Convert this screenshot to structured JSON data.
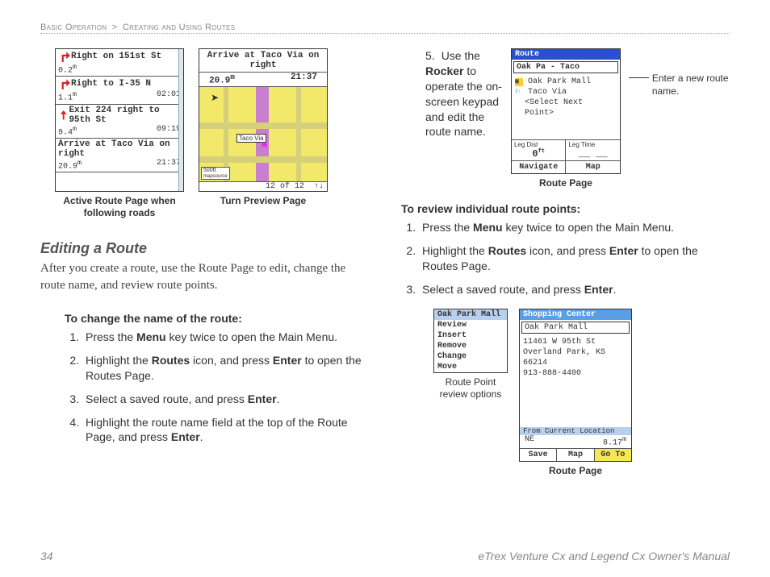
{
  "breadcrumb": {
    "a": "Basic Operation",
    "sep": ">",
    "b": "Creating and Using Routes"
  },
  "fig": {
    "active_caption": "Active Route Page when following roads",
    "turn_caption": "Turn Preview Page",
    "route_caption": "Route Page",
    "route_point_title": "Route Point review options",
    "route_caption2": "Route Page"
  },
  "active_route": {
    "rows": [
      {
        "icon": "r",
        "text": "Right on 151st St",
        "dist": "0.2",
        "unit": "m",
        "time": ""
      },
      {
        "icon": "r",
        "text": "Right to I-35 N",
        "dist": "1.1",
        "unit": "m",
        "time": "02:01"
      },
      {
        "icon": "u",
        "text": "Exit 224 right to 95th St",
        "dist": "9.4",
        "unit": "m",
        "time": "09:19"
      },
      {
        "icon": "",
        "text": "Arrive at Taco Via on right",
        "dist": "20.9",
        "unit": "m",
        "time": "21:37"
      }
    ]
  },
  "turn_preview": {
    "title": "Arrive at Taco Via on right",
    "dist": "20.9",
    "unit": "m",
    "time": "21:37",
    "label": "Taco Via",
    "scale": "500ft",
    "source": "mapsource",
    "footer": "12 of 12"
  },
  "section": {
    "editing_title": "Editing a Route",
    "editing_body": "After you create a route, use the Route Page to edit, change the route name, and review route points.",
    "change_name_h": "To change the name of the route:",
    "steps_a": [
      {
        "pre": "Press the ",
        "b": "Menu",
        "post": " key twice to open the Main Menu."
      },
      {
        "pre": "Highlight the ",
        "b": "Routes",
        "mid": " icon, and press ",
        "b2": "Enter",
        "post": " to open the Routes Page."
      },
      {
        "pre": "Select a saved route, and press ",
        "b": "Enter",
        "post": "."
      },
      {
        "pre": "Highlight the route name field at the top of the Route Page, and press ",
        "b": "Enter",
        "post": "."
      }
    ],
    "step5": {
      "num": "5.",
      "pre": "Use the ",
      "b": "Rocker",
      "post": " to operate the on-screen keypad and edit the route name."
    },
    "annot": "Enter a new route name.",
    "review_h": "To review individual route points:",
    "steps_b": [
      {
        "pre": "Press the ",
        "b": "Menu",
        "post": " key twice to open the Main Menu."
      },
      {
        "pre": "Highlight the ",
        "b": "Routes",
        "mid": " icon, and press ",
        "b2": "Enter",
        "post": " to open the Routes Page."
      },
      {
        "pre": "Select a saved route, and press ",
        "b": "Enter",
        "post": "."
      }
    ]
  },
  "route_page": {
    "title": "Route",
    "name": "Oak Pa - Taco",
    "items": [
      "Oak Park Mall",
      "Taco Via",
      "<Select Next Point>"
    ],
    "stat1_lbl": "Leg Dist",
    "stat1_val": "0",
    "stat2_lbl": "Leg Time",
    "stat2_val": "__ __",
    "btn1": "Navigate",
    "btn2": "Map"
  },
  "popup": {
    "sel": "Oak Park Mall",
    "items": [
      "Review",
      "Insert",
      "Remove",
      "Change",
      "Move"
    ]
  },
  "route_page2": {
    "title": "Shopping Center",
    "name": "Oak Park Mall",
    "addr1": "11461 W 95th St",
    "addr2": "Overland Park, KS 66214",
    "phone": "913-888-4400",
    "from_lbl": "From Current Location",
    "dir": "NE",
    "dist": "8.17",
    "unit": "m",
    "btn1": "Save",
    "btn2": "Map",
    "btn3": "Go To"
  },
  "footer": {
    "page": "34",
    "title": "eTrex Venture Cx and Legend Cx Owner's Manual"
  }
}
